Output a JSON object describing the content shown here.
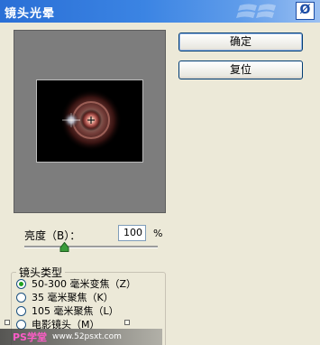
{
  "window": {
    "title": "镜头光晕",
    "close_glyph": "Ø"
  },
  "buttons": {
    "ok": "确定",
    "reset": "复位"
  },
  "brightness": {
    "label": "亮度（B）：",
    "value": "100",
    "unit": "%",
    "slider_percent": 100
  },
  "lens_type": {
    "title": "镜头类型",
    "options": [
      {
        "label": "50-300 毫米变焦（Z）",
        "checked": true
      },
      {
        "label": "35 毫米聚焦（K）",
        "checked": false
      },
      {
        "label": "105 毫米聚焦（L）",
        "checked": false
      },
      {
        "label": "电影镜头（M）",
        "checked": false
      }
    ]
  },
  "watermark": {
    "logo": "PS学堂",
    "site": "www.52psxt.com"
  },
  "colors": {
    "title_bar": "#2a6fd6",
    "flare": "#c0655e",
    "dialog_bg": "#ece9d8"
  }
}
